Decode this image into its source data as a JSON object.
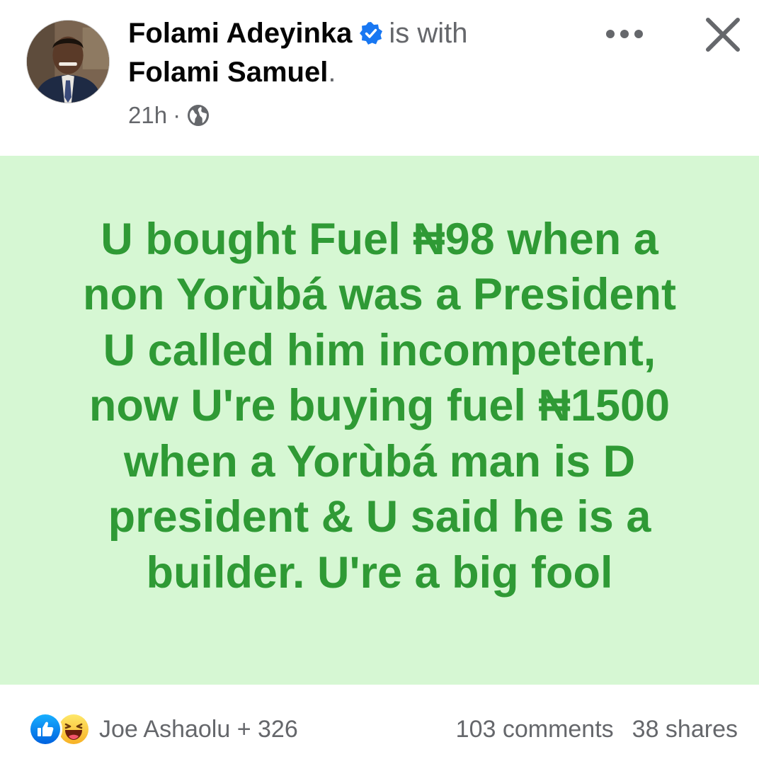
{
  "header": {
    "author": "Folami Adeyinka",
    "with_text": "is with",
    "tagged_user": "Folami Samuel",
    "tagged_suffix": ".",
    "time": "21h",
    "separator": "·",
    "privacy_icon": "globe-icon",
    "more_icon": "more-options-icon",
    "close_icon": "close-icon",
    "verified_icon": "verified-badge-icon"
  },
  "post": {
    "lines": [
      "U bought Fuel ₦98 when a",
      "non Yorùbá was a President",
      "U called him incompetent,",
      "now U're buying fuel ₦1500",
      "when a Yorùbá man is D",
      "president & U said he is a",
      "builder. U're a big fool"
    ],
    "background_color": "#d6f7d3",
    "text_color": "#2f9a35"
  },
  "footer": {
    "reaction_icons": [
      "like-reaction-icon",
      "haha-reaction-icon"
    ],
    "reactors": "Joe Ashaolu + 326",
    "comments": "103 comments",
    "shares": "38 shares"
  },
  "colors": {
    "facebook_blue": "#1877f2",
    "secondary_text": "#65676b"
  }
}
